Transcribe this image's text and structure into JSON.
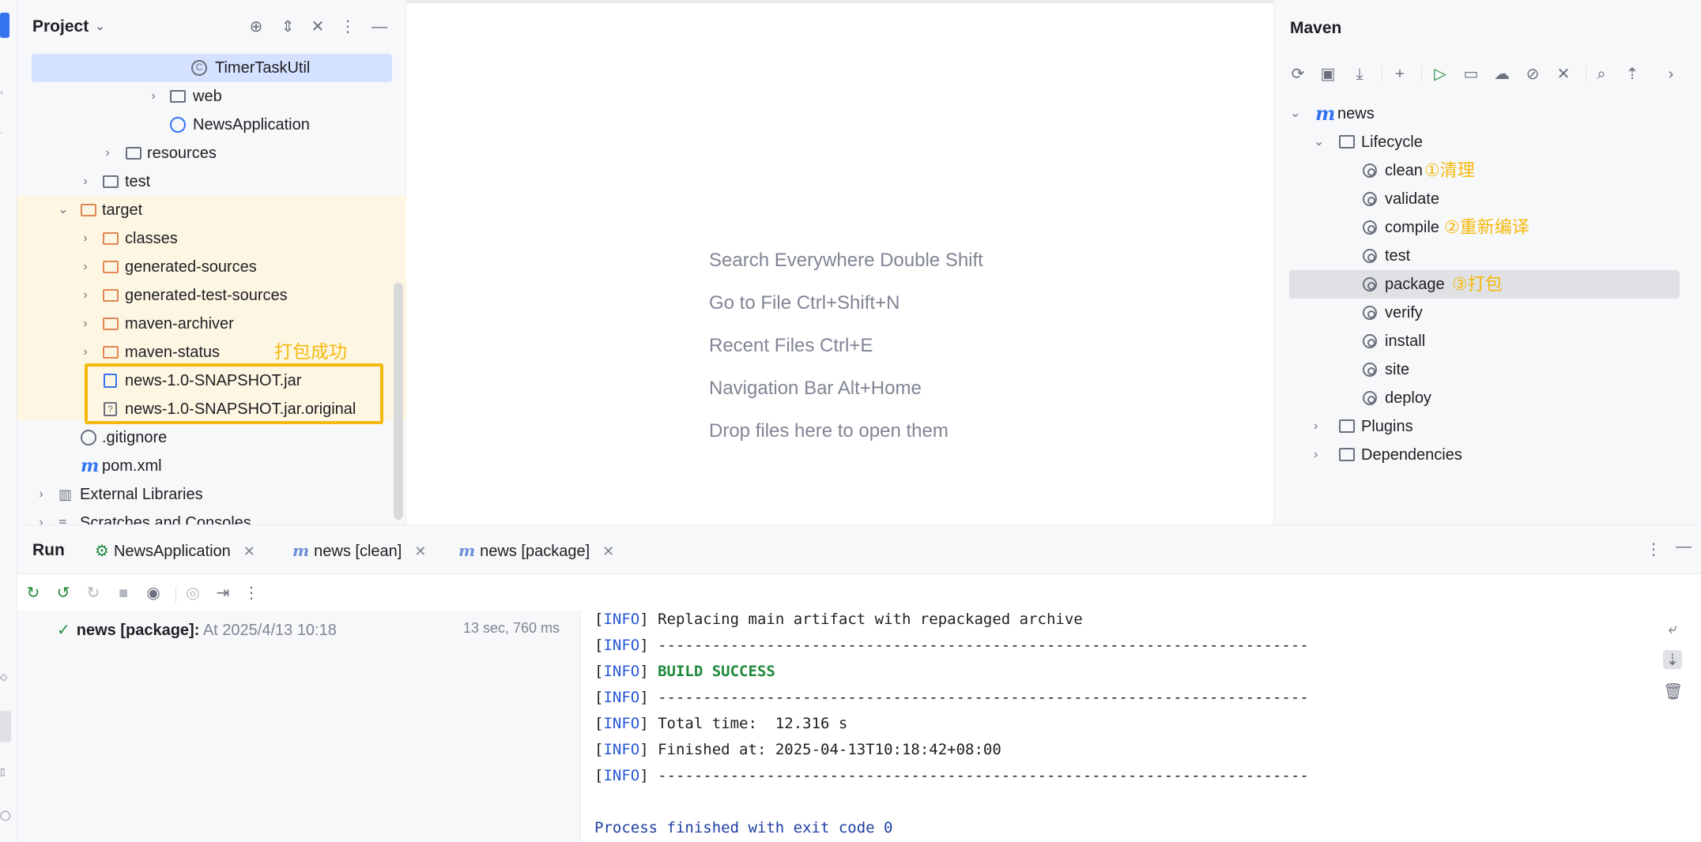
{
  "project_panel": {
    "title": "Project",
    "tree": [
      {
        "label": "TimerTaskUtil",
        "icon": "class-icon",
        "selected": true
      },
      {
        "label": "web",
        "icon": "package-icon"
      },
      {
        "label": "NewsApplication",
        "icon": "spring-boot-class-icon"
      },
      {
        "label": "resources",
        "icon": "resources-folder-icon"
      },
      {
        "label": "test",
        "icon": "folder-icon"
      },
      {
        "label": "target",
        "icon": "excluded-folder-icon"
      },
      {
        "label": "classes",
        "icon": "excluded-folder-icon"
      },
      {
        "label": "generated-sources",
        "icon": "excluded-folder-icon"
      },
      {
        "label": "generated-test-sources",
        "icon": "excluded-folder-icon"
      },
      {
        "label": "maven-archiver",
        "icon": "excluded-folder-icon"
      },
      {
        "label": "maven-status",
        "icon": "excluded-folder-icon"
      },
      {
        "label": "news-1.0-SNAPSHOT.jar",
        "icon": "jar-icon"
      },
      {
        "label": "news-1.0-SNAPSHOT.jar.original",
        "icon": "unknown-file-icon"
      },
      {
        "label": ".gitignore",
        "icon": "ignored-file-icon"
      },
      {
        "label": "pom.xml",
        "icon": "maven-icon"
      },
      {
        "label": "External Libraries",
        "icon": "libraries-icon"
      },
      {
        "label": "Scratches and Consoles",
        "icon": "scratches-icon"
      }
    ],
    "annotation": "打包成功"
  },
  "editor": {
    "hints": [
      "Search Everywhere Double Shift",
      "Go to File Ctrl+Shift+N",
      "Recent Files Ctrl+E",
      "Navigation Bar Alt+Home",
      "Drop files here to open them"
    ]
  },
  "maven_panel": {
    "title": "Maven",
    "project": "news",
    "lifecycle_label": "Lifecycle",
    "goals": [
      {
        "label": "clean",
        "annotation": "①清理"
      },
      {
        "label": "validate",
        "annotation": ""
      },
      {
        "label": "compile",
        "annotation": "②重新编译"
      },
      {
        "label": "test",
        "annotation": ""
      },
      {
        "label": "package",
        "annotation": "③打包",
        "selected": true
      },
      {
        "label": "verify",
        "annotation": ""
      },
      {
        "label": "install",
        "annotation": ""
      },
      {
        "label": "site",
        "annotation": ""
      },
      {
        "label": "deploy",
        "annotation": ""
      }
    ],
    "plugins_label": "Plugins",
    "dependencies_label": "Dependencies"
  },
  "run_window": {
    "title": "Run",
    "tabs": [
      {
        "label": "NewsApplication",
        "icon": "spring-boot-icon"
      },
      {
        "label": "news [clean]",
        "icon": "maven-icon"
      },
      {
        "label": "news [package]",
        "icon": "maven-icon",
        "active": true
      }
    ],
    "run_item": {
      "name": "news [package]:",
      "detail": "At 2025/4/13 10:18",
      "duration": "13 sec, 760 ms"
    },
    "console_lines": [
      {
        "level": "INFO",
        "text": "Replacing main artifact with repackaged archive"
      },
      {
        "level": "INFO",
        "text": "------------------------------------------------------------------------"
      },
      {
        "level": "INFO",
        "text": "BUILD SUCCESS"
      },
      {
        "level": "INFO",
        "text": "------------------------------------------------------------------------"
      },
      {
        "level": "INFO",
        "text": "Total time:  12.316 s"
      },
      {
        "level": "INFO",
        "text": "Finished at: 2025-04-13T10:18:42+08:00"
      },
      {
        "level": "INFO",
        "text": "------------------------------------------------------------------------"
      }
    ],
    "exit_line": "Process finished with exit code 0"
  },
  "colors": {
    "accent": "#3574f0",
    "annotation": "#f5b90f",
    "success": "#208a3c",
    "selection": "#d4e2ff",
    "excluded_bg": "#fdf6e3"
  }
}
